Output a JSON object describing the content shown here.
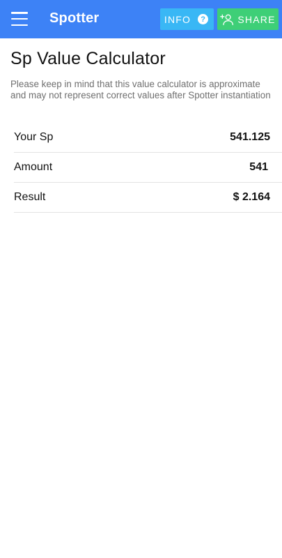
{
  "appbar": {
    "title": "Spotter",
    "menu_icon": "hamburger-menu-icon",
    "info_label": "INFO",
    "info_icon": "question-circle-icon",
    "share_label": "SHARE",
    "share_icon": "add-person-icon",
    "colors": {
      "bar": "#3d82f6",
      "info": "#39b7f5",
      "share": "#3ecf77"
    }
  },
  "page": {
    "title": "Sp Value Calculator",
    "note": "Please keep in mind that this value calculator is approximate and may not represent correct values after Spotter instantiation"
  },
  "rows": [
    {
      "label": "Your Sp",
      "value": "541.125"
    },
    {
      "label": "Amount",
      "value": "541"
    },
    {
      "label": "Result",
      "value": "$ 2.164"
    }
  ]
}
